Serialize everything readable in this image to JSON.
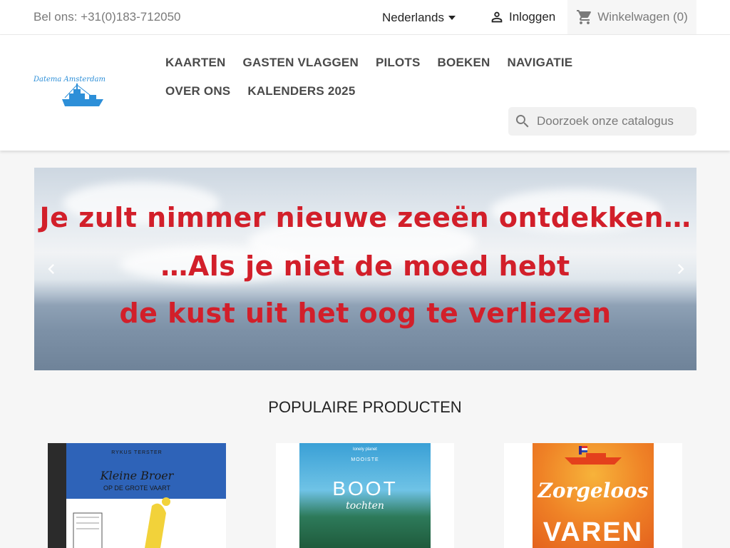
{
  "topbar": {
    "phone": "Bel ons: +31(0)183-712050",
    "language": "Nederlands",
    "login": "Inloggen",
    "cart": "Winkelwagen (0)"
  },
  "logo": {
    "text": "Datema Amsterdam"
  },
  "nav": {
    "items": [
      "KAARTEN",
      "GASTEN VLAGGEN",
      "PILOTS",
      "BOEKEN",
      "NAVIGATIE",
      "OVER ONS",
      "KALENDERS 2025"
    ]
  },
  "search": {
    "placeholder": "Doorzoek onze catalogus"
  },
  "carousel": {
    "line1": "Je zult nimmer nieuwe zeeën ontdekken…",
    "line2": "…Als je niet de moed hebt",
    "line3": "de kust uit het oog te verliezen"
  },
  "products": {
    "title": "POPULAIRE PRODUCTEN",
    "items": [
      {
        "author": "RYKUS TERSTER",
        "title": "Kleine Broer",
        "subtitle": "OP DE GROTE VAART"
      },
      {
        "publisher": "lonely planet",
        "kicker": "MOOISTE",
        "title": "BOOT",
        "subtitle": "tochten"
      },
      {
        "title": "Zorgeloos",
        "title2": "VAREN"
      }
    ]
  },
  "colors": {
    "accent": "#2d8fd8",
    "slogan": "#d21f2a"
  }
}
